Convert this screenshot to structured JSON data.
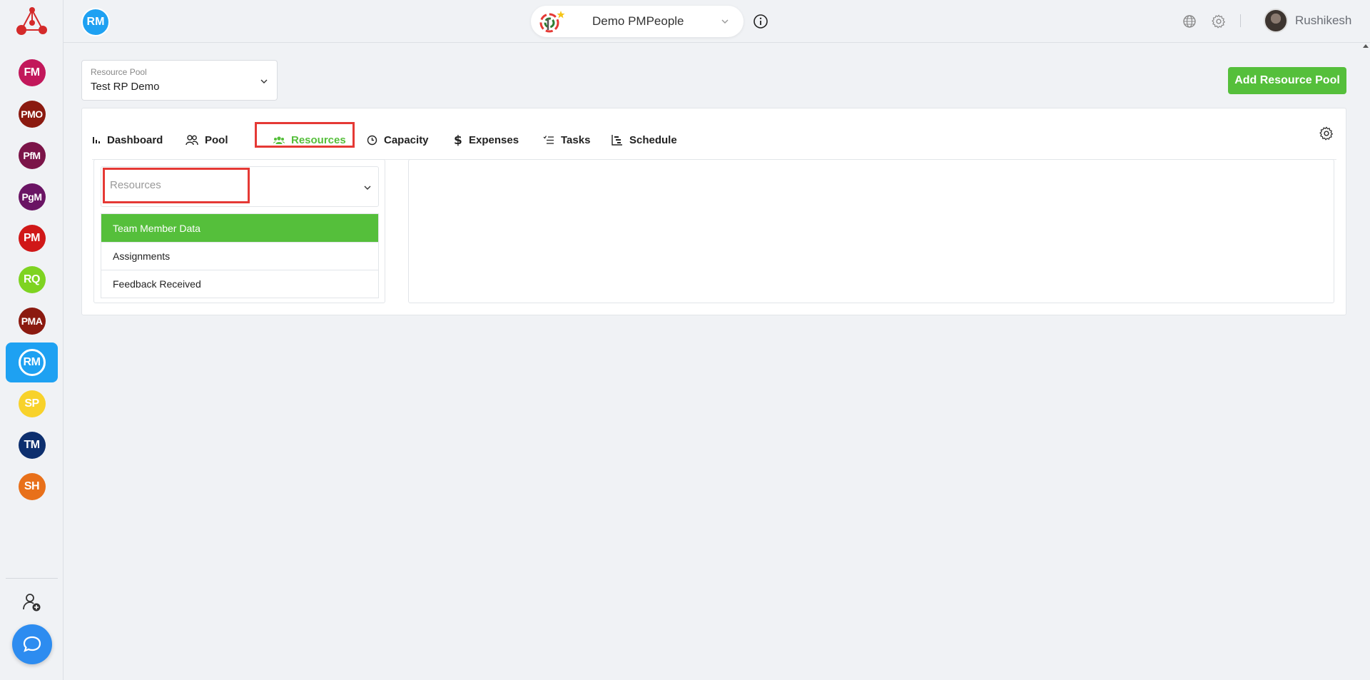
{
  "sidebar": {
    "apps": [
      {
        "abbr": "FM",
        "color": "#c2185b"
      },
      {
        "abbr": "PMO",
        "color": "#8b1a10"
      },
      {
        "abbr": "PfM",
        "color": "#7b1448"
      },
      {
        "abbr": "PgM",
        "color": "#6a1464"
      },
      {
        "abbr": "PM",
        "color": "#d01818"
      },
      {
        "abbr": "RQ",
        "color": "#7ed321"
      },
      {
        "abbr": "PMA",
        "color": "#8b1a10"
      },
      {
        "abbr": "RM",
        "color": "#1ea1f2"
      },
      {
        "abbr": "SP",
        "color": "#f8d22b"
      },
      {
        "abbr": "TM",
        "color": "#0d2f6e"
      },
      {
        "abbr": "SH",
        "color": "#e8701a"
      }
    ],
    "active_app": "RM"
  },
  "topbar": {
    "module_badge": "RM",
    "workspace_name": "Demo PMPeople",
    "user_name": "Rushikesh"
  },
  "pool_select": {
    "label": "Resource Pool",
    "value": "Test RP Demo"
  },
  "add_pool_button": "Add Resource Pool",
  "tabs": [
    {
      "label": "Dashboard",
      "icon": "bar-chart-icon"
    },
    {
      "label": "Pool",
      "icon": "people-icon"
    },
    {
      "label": "Resources",
      "icon": "group-icon",
      "active": true
    },
    {
      "label": "Capacity",
      "icon": "clock-icon"
    },
    {
      "label": "Expenses",
      "icon": "dollar-icon"
    },
    {
      "label": "Tasks",
      "icon": "task-list-icon"
    },
    {
      "label": "Schedule",
      "icon": "gantt-icon"
    }
  ],
  "resources_select": {
    "placeholder": "Resources"
  },
  "resource_menu": [
    {
      "label": "Team Member Data",
      "selected": true
    },
    {
      "label": "Assignments"
    },
    {
      "label": "Feedback Received"
    }
  ],
  "colors": {
    "accent_green": "#55bf3b",
    "accent_blue": "#1ea1f2",
    "highlight_red": "#e53935"
  }
}
